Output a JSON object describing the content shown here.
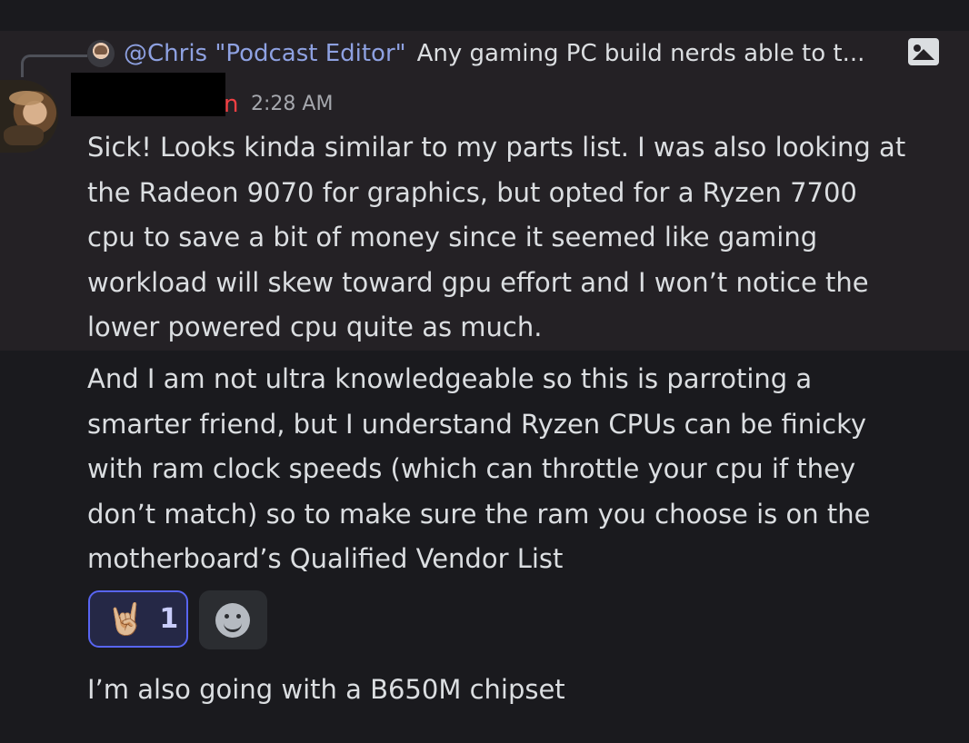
{
  "reply": {
    "mention": "@Chris \"Podcast Editor\"",
    "snippet": "Any gaming PC build nerds able to t...",
    "attachment_icon": "image-icon"
  },
  "author": {
    "name_visible_fragment": "n",
    "timestamp": "2:28 AM"
  },
  "messages": [
    "Sick! Looks kinda similar to my parts list. I was also looking at\nthe Radeon 9070 for graphics, but opted for a Ryzen 7700\ncpu to save a bit of money since it seemed like gaming\nworkload will skew toward gpu effort and I won’t notice the\nlower powered cpu quite as much.",
    "And I am not ultra knowledgeable so this is parroting a\nsmarter friend, but I understand Ryzen CPUs can be finicky\nwith ram clock speeds (which can throttle your cpu if they\ndon’t match) so to make sure the ram you choose is on the\nmotherboard’s Qualified Vendor List",
    "I’m also going with a B650M chipset"
  ],
  "reactions": [
    {
      "emoji": "🤘🏼",
      "count": "1",
      "active": true
    }
  ],
  "add_reaction_icon": "smile-icon",
  "colors": {
    "background": "#1a1a1e",
    "highlight": "#242125",
    "mention": "#8ea1e1",
    "accent": "#5865f2",
    "username": "#f23f43"
  }
}
